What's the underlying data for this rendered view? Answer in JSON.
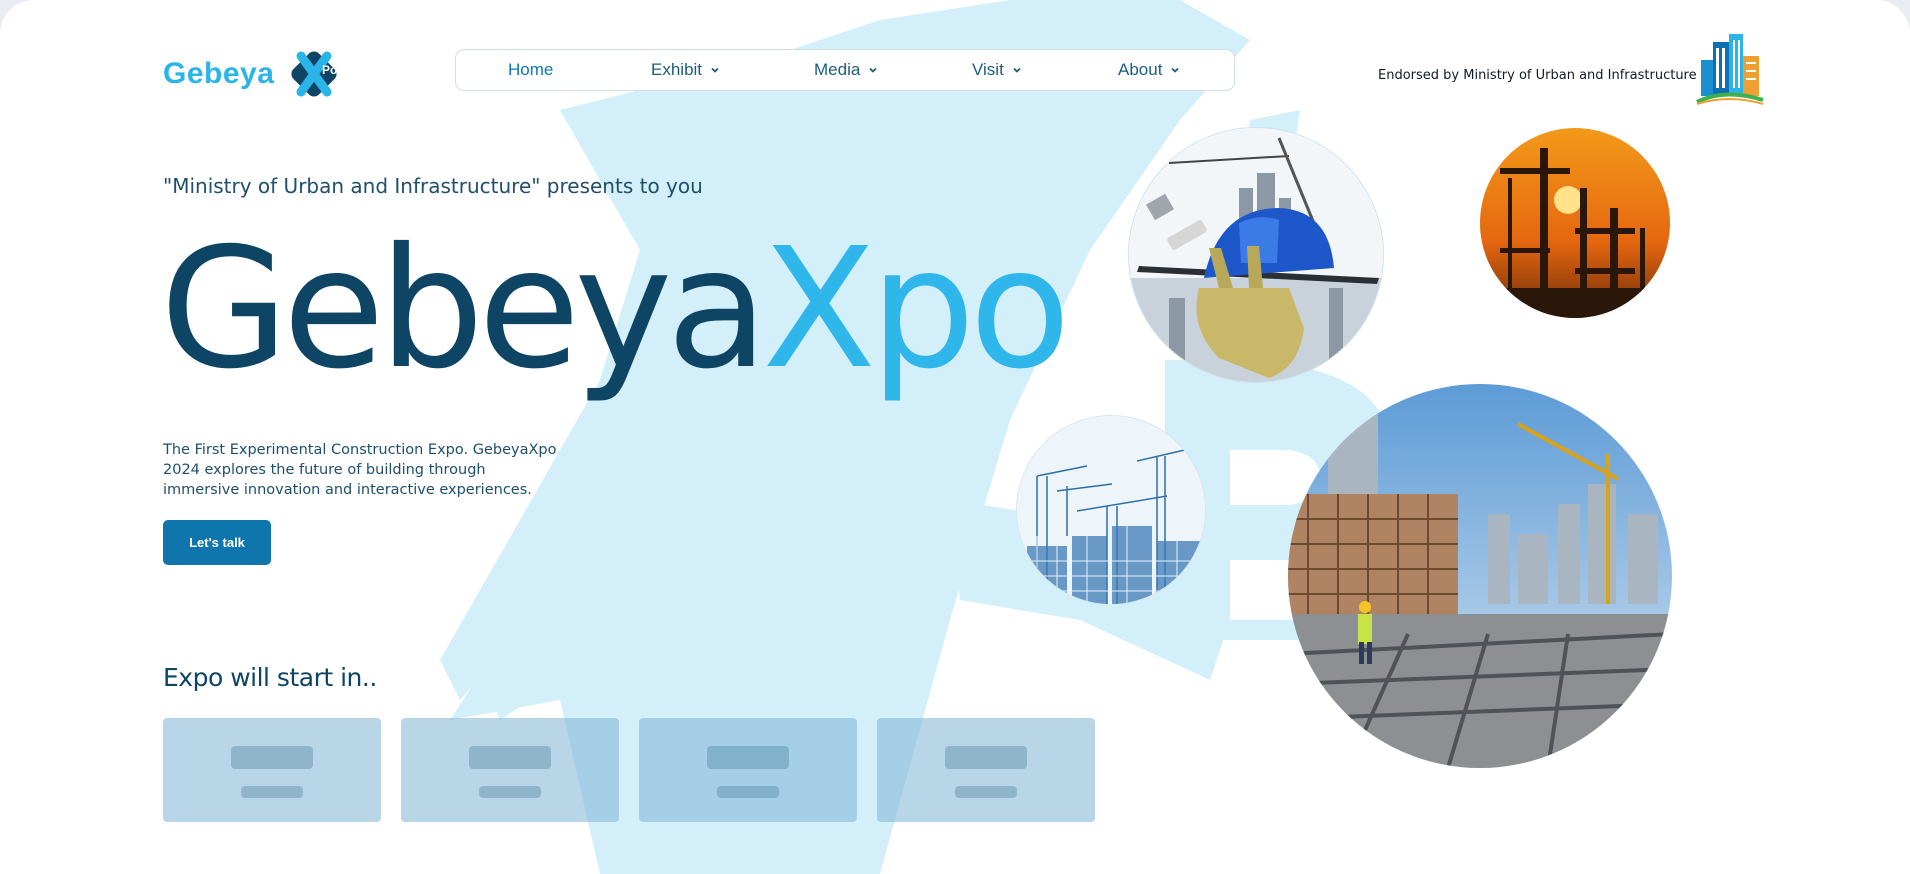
{
  "brand": {
    "name": "Gebeya",
    "mark_text": "Xpo",
    "primary_color": "#2bb4e8",
    "dark_color": "#0e4464"
  },
  "nav": {
    "items": [
      {
        "label": "Home",
        "active": true,
        "has_dropdown": false
      },
      {
        "label": "Exhibit",
        "active": false,
        "has_dropdown": true
      },
      {
        "label": "Media",
        "active": false,
        "has_dropdown": true
      },
      {
        "label": "Visit",
        "active": false,
        "has_dropdown": true
      },
      {
        "label": "About",
        "active": false,
        "has_dropdown": true
      }
    ]
  },
  "endorsement": {
    "text": "Endorsed by Ministry of Urban and Infrastructure",
    "logo_icon": "city-buildings-icon"
  },
  "hero": {
    "presents": "\"Ministry of Urban and Infrastructure\" presents to you",
    "title_part1": "Gebeya",
    "title_part2": "Xpo",
    "description": "The First Experimental Construction Expo. GebeyaXpo 2024 explores the future of building through immersive innovation and interactive experiences.",
    "cta_label": "Let's talk"
  },
  "countdown": {
    "title": "Expo will start in..",
    "box_count": 4
  },
  "photos": [
    {
      "name": "helmet-tools-photo"
    },
    {
      "name": "sunset-construction-photo"
    },
    {
      "name": "cranes-sketch-photo"
    },
    {
      "name": "construction-site-photo"
    }
  ]
}
